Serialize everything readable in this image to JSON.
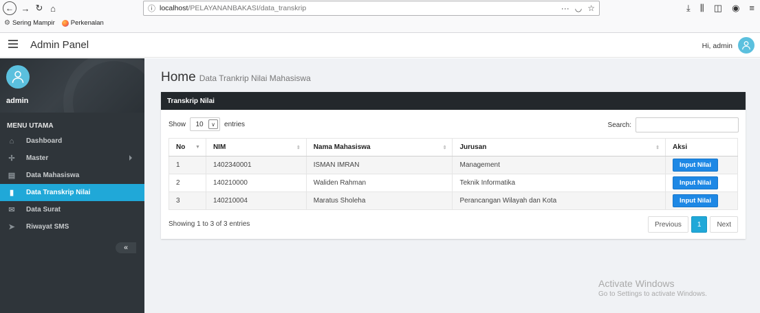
{
  "browser": {
    "url_host": "localhost",
    "url_path": "/PELAYANANBAKASI/data_transkrip",
    "bookmarks": [
      "Sering Mampir",
      "Perkenalan"
    ]
  },
  "header": {
    "title": "Admin Panel",
    "greeting": "Hi, admin"
  },
  "sidebar": {
    "username": "admin",
    "menu_title": "MENU UTAMA",
    "items": [
      {
        "label": "Dashboard",
        "icon": "home-icon"
      },
      {
        "label": "Master",
        "icon": "fan-icon"
      },
      {
        "label": "Data Mahasiswa",
        "icon": "id-card-icon"
      },
      {
        "label": "Data Transkrip Nilai",
        "icon": "clipboard-icon"
      },
      {
        "label": "Data Surat",
        "icon": "envelope-icon"
      },
      {
        "label": "Riwayat SMS",
        "icon": "paper-plane-icon"
      }
    ],
    "active_index": 3,
    "collapse_label": "«"
  },
  "main": {
    "heading": "Home",
    "subheading": "Data Trankrip Nilai Mahasiswa",
    "card_title": "Transkrip Nilai",
    "length_prefix": "Show",
    "length_value": "10",
    "length_suffix": "entries",
    "search_label": "Search:",
    "columns": [
      "No",
      "NIM",
      "Nama Mahasiswa",
      "Jurusan",
      "Aksi"
    ],
    "rows": [
      {
        "no": "1",
        "nim": "1402340001",
        "nama": "ISMAN IMRAN",
        "jurusan": "Management",
        "aksi": "Input Nilai"
      },
      {
        "no": "2",
        "nim": "140210000",
        "nama": "Waliden Rahman",
        "jurusan": "Teknik Informatika",
        "aksi": "Input Nilai"
      },
      {
        "no": "3",
        "nim": "140210004",
        "nama": "Maratus Sholeha",
        "jurusan": "Perancangan Wilayah dan Kota",
        "aksi": "Input Nilai"
      }
    ],
    "info": "Showing 1 to 3 of 3 entries",
    "pagination": {
      "previous": "Previous",
      "current": "1",
      "next": "Next"
    }
  },
  "watermark": {
    "title": "Activate Windows",
    "subtitle": "Go to Settings to activate Windows."
  },
  "colors": {
    "accent": "#20a8d8",
    "sidebar_bg": "#2f353a",
    "button_blue": "#1e88e5",
    "card_header_bg": "#23282c"
  }
}
